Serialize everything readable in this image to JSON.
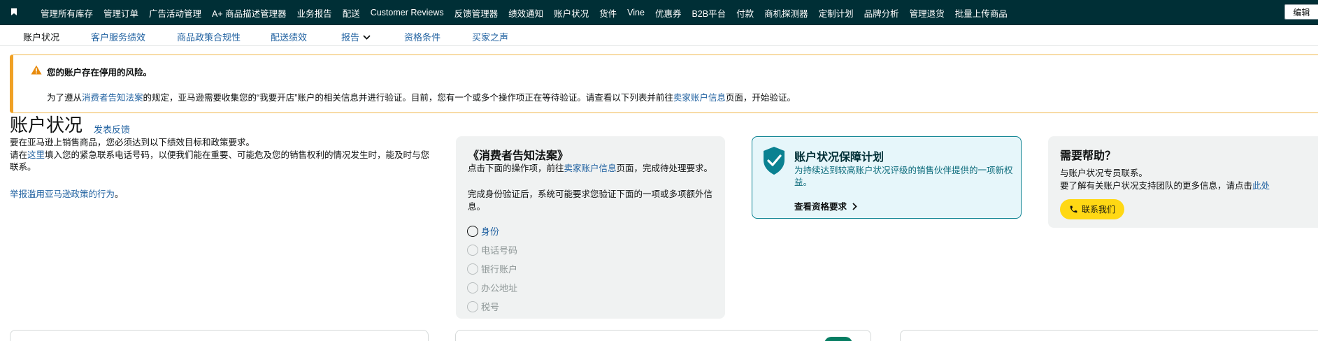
{
  "topnav": {
    "items": [
      "管理所有库存",
      "管理订单",
      "广告活动管理",
      "A+ 商品描述管理器",
      "业务报告",
      "配送",
      "Customer Reviews",
      "反馈管理器",
      "绩效通知",
      "账户状况",
      "货件",
      "Vine",
      "优惠券",
      "B2B平台",
      "付款",
      "商机探测器",
      "定制计划",
      "品牌分析",
      "管理退货",
      "批量上传商品"
    ],
    "edit_label": "编辑"
  },
  "subnav": {
    "items": [
      "账户状况",
      "客户服务绩效",
      "商品政策合规性",
      "配送绩效",
      "报告",
      "资格条件",
      "买家之声"
    ]
  },
  "alert": {
    "title": "您的账户存在停用的风险。",
    "body_prefix": "为了遵从",
    "body_link1": "消费者告知法案",
    "body_mid": "的规定，亚马逊需要收集您的“我要开店”账户的相关信息并进行验证。目前，您有一个或多个操作项正在等待验证。请查看以下列表并前往",
    "body_link2": "卖家账户信息",
    "body_suffix": "页面，开始验证。"
  },
  "page": {
    "title": "账户状况",
    "feedback": "发表反馈",
    "intro_line1": "要在亚马逊上销售商品，您必须达到以下绩效目标和政策要求。",
    "intro_line2_prefix": "请在",
    "intro_line2_link": "这里",
    "intro_line2_suffix": "填入您的紧急联系电话号码，以便我们能在重要、可能危及您的销售权利的情况发生时，能及时与您联系。",
    "report_link": "举报滥用亚马逊政策的行为",
    "report_suffix": "。"
  },
  "informed_card": {
    "title": "《消费者告知法案》",
    "p1_prefix": "点击下面的操作项，前往",
    "p1_link": "卖家账户信息",
    "p1_suffix": "页面，完成待处理要求。",
    "p2": "完成身份验证后，系统可能要求您验证下面的一项或多项额外信息。",
    "items": [
      {
        "label": "身份",
        "active": true
      },
      {
        "label": "电话号码",
        "active": false
      },
      {
        "label": "银行账户",
        "active": false
      },
      {
        "label": "办公地址",
        "active": false
      },
      {
        "label": "税号",
        "active": false
      }
    ]
  },
  "protect_card": {
    "title": "账户状况保障计划",
    "desc": "为持续达到较高账户状况评级的销售伙伴提供的一项新权益。",
    "cta": "查看资格要求"
  },
  "help_card": {
    "title": "需要帮助？",
    "d1": "与账户状况专员联系。",
    "d2_prefix": "要了解有关账户状况支持团队的更多信息，请点击",
    "d2_link": "此处",
    "contact": "联系我们"
  },
  "colors": {
    "topnav_bg": "#002f36",
    "link": "#2162a1",
    "alert_border": "#f0a125",
    "protect_bg": "#e6f6fa",
    "protect_accent": "#0a8191",
    "contact_button": "#ffd814"
  }
}
